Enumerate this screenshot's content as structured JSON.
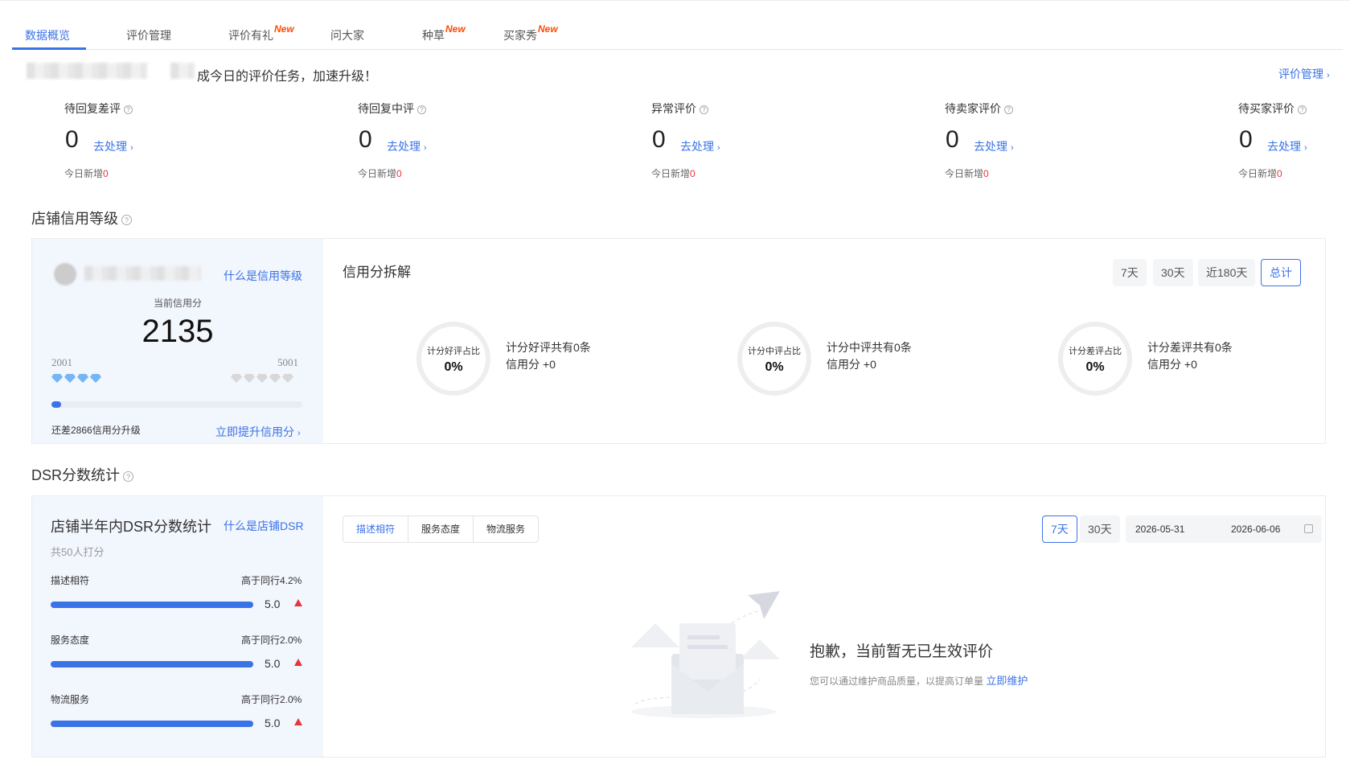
{
  "tabs": [
    {
      "label": "数据概览",
      "new": "",
      "active": true
    },
    {
      "label": "评价管理",
      "new": ""
    },
    {
      "label": "评价有礼",
      "new": "New"
    },
    {
      "label": "问大家",
      "new": ""
    },
    {
      "label": "种草",
      "new": "New"
    },
    {
      "label": "买家秀",
      "new": "New"
    }
  ],
  "banner": {
    "text": "成今日的评价任务，加速升级！",
    "manage_link": "评价管理"
  },
  "stats": [
    {
      "title": "待回复差评",
      "value": "0",
      "action": "去处理",
      "today_label": "今日新增",
      "today_value": "0"
    },
    {
      "title": "待回复中评",
      "value": "0",
      "action": "去处理",
      "today_label": "今日新增",
      "today_value": "0"
    },
    {
      "title": "异常评价",
      "value": "0",
      "action": "去处理",
      "today_label": "今日新增",
      "today_value": "0"
    },
    {
      "title": "待卖家评价",
      "value": "0",
      "action": "去处理",
      "today_label": "今日新增",
      "today_value": "0"
    },
    {
      "title": "待买家评价",
      "value": "0",
      "action": "去处理",
      "today_label": "今日新增",
      "today_value": "0"
    }
  ],
  "credit": {
    "section_title": "店铺信用等级",
    "what_link": "什么是信用等级",
    "current_label": "当前信用分",
    "score": "2135",
    "level_low": "2001",
    "level_high": "5001",
    "progress": 0.04,
    "gap_text": "还差2866信用分升级",
    "improve_link": "立即提升信用分"
  },
  "breakdown": {
    "title": "信用分拆解",
    "periods": [
      "7天",
      "30天",
      "近180天",
      "总计"
    ],
    "active_period": "总计",
    "rings": [
      {
        "label": "计分好评占比",
        "value": "0%",
        "count": "计分好评共有0条",
        "score": "信用分 +0"
      },
      {
        "label": "计分中评占比",
        "value": "0%",
        "count": "计分中评共有0条",
        "score": "信用分 +0"
      },
      {
        "label": "计分差评占比",
        "value": "0%",
        "count": "计分差评共有0条",
        "score": "信用分 +0"
      }
    ]
  },
  "dsr": {
    "section_title": "DSR分数统计",
    "card_title": "店铺半年内DSR分数统计",
    "what_link": "什么是店铺DSR",
    "raters": "共50人打分",
    "rows": [
      {
        "label": "描述相符",
        "compare": "高于同行4.2%",
        "score": "5.0"
      },
      {
        "label": "服务态度",
        "compare": "高于同行2.0%",
        "score": "5.0"
      },
      {
        "label": "物流服务",
        "compare": "高于同行2.0%",
        "score": "5.0"
      }
    ],
    "segments": [
      "描述相符",
      "服务态度",
      "物流服务"
    ],
    "periods": [
      "7天",
      "30天"
    ],
    "date_start": "2026-05-31",
    "date_end": "2026-06-06",
    "empty_title": "抱歉，当前暂无已生效评价",
    "empty_sub": "您可以通过维护商品质量，以提高订单量",
    "empty_link": "立即维护"
  },
  "colors": {
    "accent": "#3a72e8",
    "new_badge": "#ff4a00",
    "alert": "#e8353b"
  }
}
